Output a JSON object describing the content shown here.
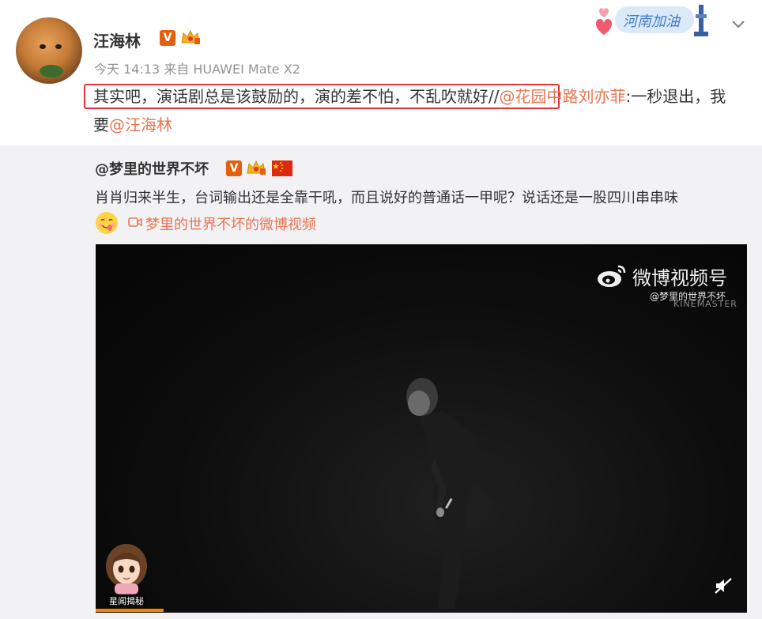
{
  "header": {
    "username": "汪海林",
    "verified_badge": "V",
    "meta": "今天 14:13 来自 HUAWEI Mate X2",
    "festive_text": "河南加油",
    "menu_icon": "chevron-down-icon"
  },
  "post": {
    "highlighted_text": "其实吧，演话剧总是该鼓励的，演的差不怕，不乱吹就好",
    "slash1": "//",
    "mention1": "@花园中路刘亦菲",
    "after_mention1": ":一秒退出，我要",
    "mention2": "@汪海林"
  },
  "retweet": {
    "username": "@梦里的世界不坏",
    "verified_badge": "V",
    "text": "肖肖归来半生，台词输出还是全靠干吼，而且说好的普通话一甲呢？说话还是一股四川串串味",
    "video_link": "梦里的世界不坏的微博视频"
  },
  "video": {
    "watermark_title": "微博视频号",
    "watermark_user": "@梦里的世界不坏",
    "watermark_brand": "KINEMASTER",
    "corner_label": "星闻揭秘",
    "progress_percent": 10
  },
  "colors": {
    "accent": "#eb7350",
    "highlight_box": "#e5333a",
    "verified": "#e55f10",
    "progress": "#ff8200"
  }
}
